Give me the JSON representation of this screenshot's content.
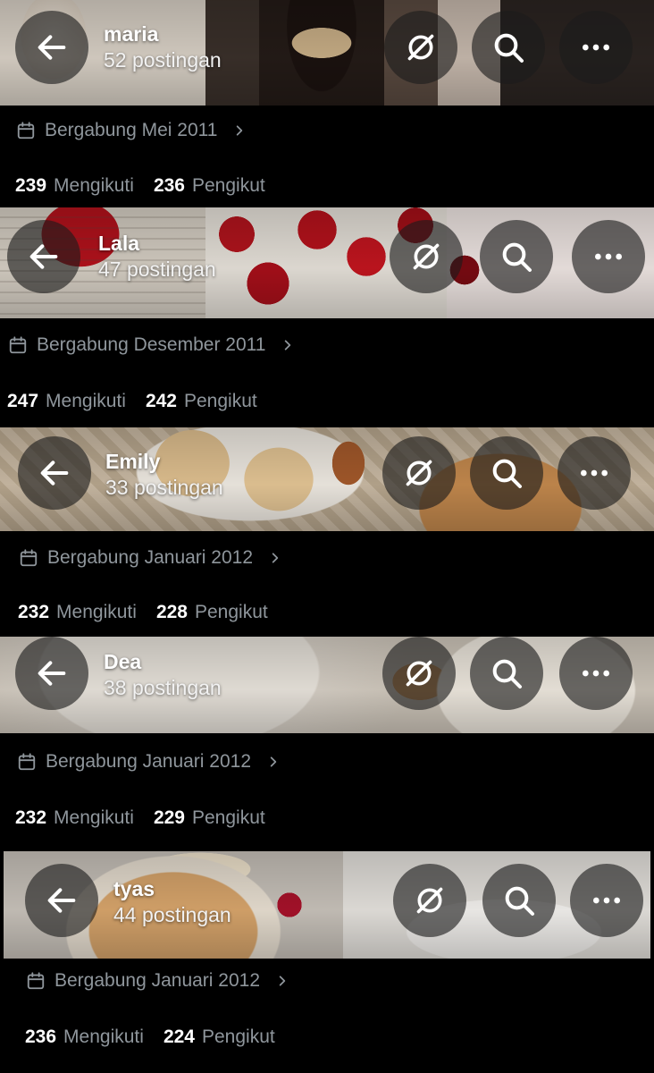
{
  "labels": {
    "following": "Mengikuti",
    "followers": "Pengikut"
  },
  "profiles": [
    {
      "name": "maria",
      "posts": "52 postingan",
      "joined": "Bergabung Mei 2011",
      "following": "239",
      "followers": "236"
    },
    {
      "name": "Lala",
      "posts": "47 postingan",
      "joined": "Bergabung Desember 2011",
      "following": "247",
      "followers": "242"
    },
    {
      "name": "Emily",
      "posts": "33 postingan",
      "joined": "Bergabung Januari 2012",
      "following": "232",
      "followers": "228"
    },
    {
      "name": "Dea",
      "posts": "38 postingan",
      "joined": "Bergabung Januari 2012",
      "following": "232",
      "followers": "229"
    },
    {
      "name": "tyas",
      "posts": "44 postingan",
      "joined": "Bergabung Januari 2012",
      "following": "236",
      "followers": "224"
    }
  ],
  "icons": {
    "back": "arrow-left-icon",
    "grok": "grok-icon",
    "search": "search-icon",
    "more": "more-horizontal-icon",
    "calendar": "calendar-icon",
    "chevron": "chevron-right-icon"
  },
  "colors": {
    "background": "#000000",
    "muted_text": "#8f969c",
    "button_bg": "rgba(28,28,28,0.62)"
  }
}
